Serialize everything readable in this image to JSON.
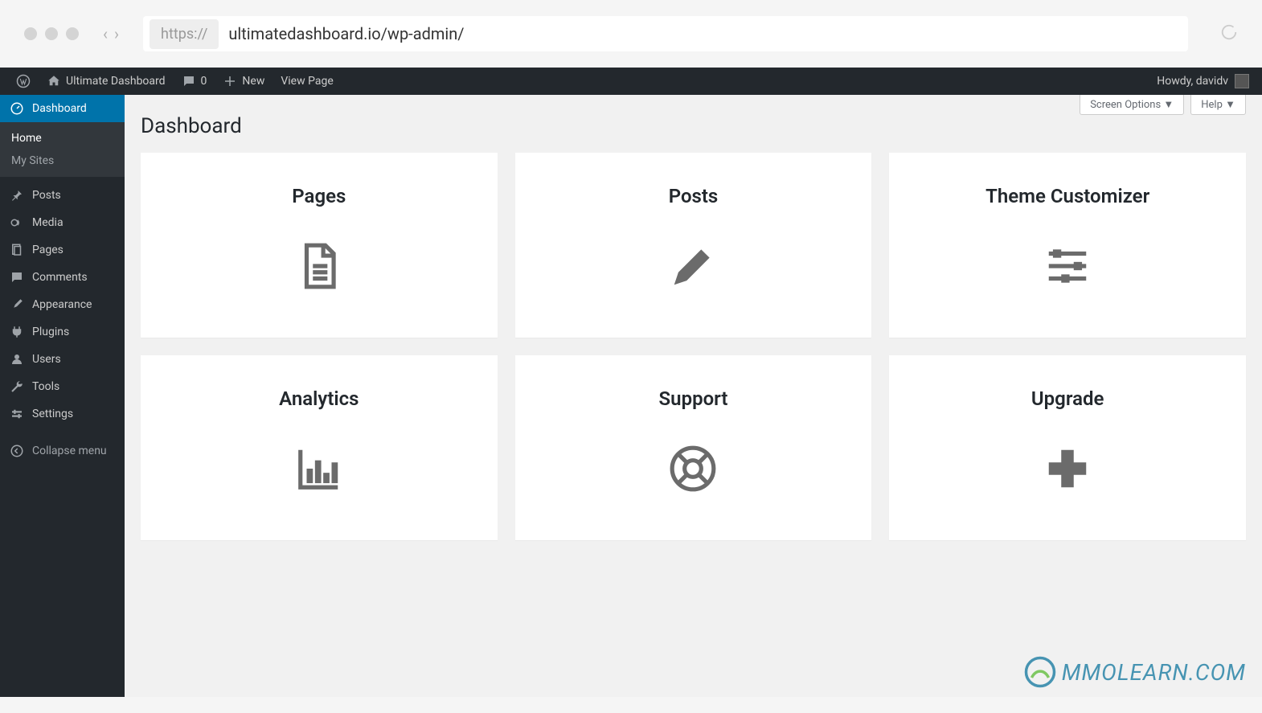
{
  "browser": {
    "protocol": "https://",
    "url": "ultimatedashboard.io/wp-admin/"
  },
  "adminbar": {
    "site_title": "Ultimate Dashboard",
    "comments_count": "0",
    "new_label": "New",
    "view_page_label": "View Page",
    "greeting": "Howdy, davidv"
  },
  "sidebar": {
    "items": [
      {
        "label": "Dashboard",
        "icon": "dashboard-icon",
        "active": true
      },
      {
        "label": "Posts",
        "icon": "pin-icon"
      },
      {
        "label": "Media",
        "icon": "media-icon"
      },
      {
        "label": "Pages",
        "icon": "page-icon"
      },
      {
        "label": "Comments",
        "icon": "comment-icon"
      },
      {
        "label": "Appearance",
        "icon": "brush-icon"
      },
      {
        "label": "Plugins",
        "icon": "plug-icon"
      },
      {
        "label": "Users",
        "icon": "user-icon"
      },
      {
        "label": "Tools",
        "icon": "wrench-icon"
      },
      {
        "label": "Settings",
        "icon": "settings-icon"
      }
    ],
    "submenu": [
      "Home",
      "My Sites"
    ],
    "collapse_label": "Collapse menu"
  },
  "main": {
    "screen_options": "Screen Options",
    "help": "Help",
    "page_title": "Dashboard",
    "widgets": [
      {
        "title": "Pages",
        "icon": "doc"
      },
      {
        "title": "Posts",
        "icon": "pencil"
      },
      {
        "title": "Theme Customizer",
        "icon": "sliders"
      },
      {
        "title": "Analytics",
        "icon": "chart"
      },
      {
        "title": "Support",
        "icon": "lifebuoy"
      },
      {
        "title": "Upgrade",
        "icon": "plus"
      }
    ]
  },
  "watermark": "MMOLEARN.COM"
}
